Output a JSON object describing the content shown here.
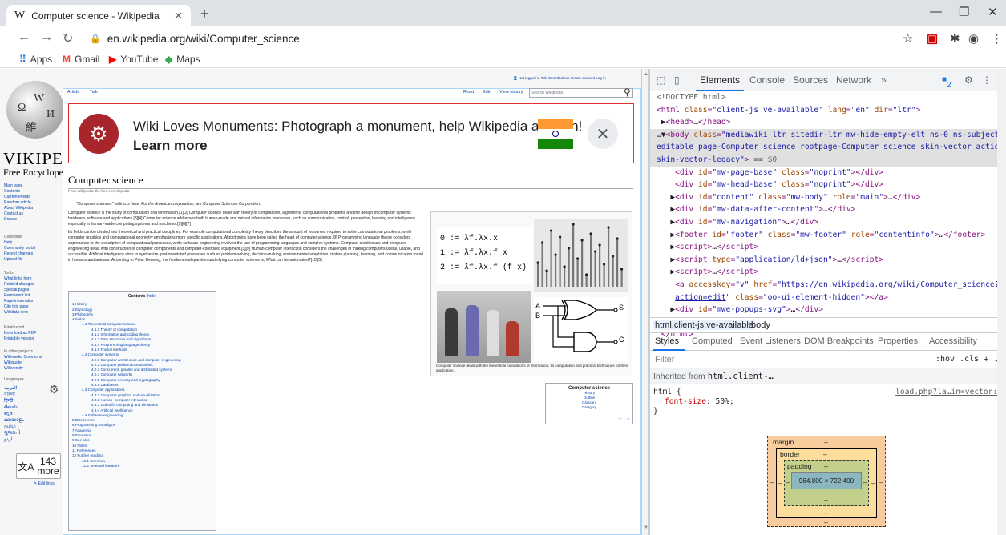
{
  "browser": {
    "tab_title": "Computer science - Wikipedia",
    "tab_favicon": "W",
    "new_tab": "+",
    "url": "en.wikipedia.org/wiki/Computer_science",
    "bookmarks": [
      {
        "label": "Apps",
        "icon": "apps-grid-icon",
        "color": "#1a73e8"
      },
      {
        "label": "Gmail",
        "icon": "gmail-icon",
        "color": "#ea4335"
      },
      {
        "label": "YouTube",
        "icon": "youtube-icon",
        "color": "#ff0000"
      },
      {
        "label": "Maps",
        "icon": "maps-icon",
        "color": "#34a853"
      }
    ]
  },
  "wiki": {
    "wordmark": "VIKIPEDI",
    "tagline": "Free Encyclope",
    "personal": "Not logged in  Talk  Contributions  Create account  Log in",
    "tabs": {
      "article": "Article",
      "talk": "Talk",
      "read": "Read",
      "edit": "Edit",
      "history": "View history"
    },
    "search_placeholder": "Search Wikipedia",
    "sidebar": {
      "nav": [
        "Main page",
        "Contents",
        "Current events",
        "Random article",
        "About Wikipedia",
        "Contact us",
        "Donate"
      ],
      "contribute_h": "Contribute",
      "contribute": [
        "Help",
        "Community portal",
        "Recent changes",
        "Upload file"
      ],
      "tools_h": "Tools",
      "tools": [
        "What links here",
        "Related changes",
        "Special pages",
        "Permanent link",
        "Page information",
        "Cite this page",
        "Wikidata item"
      ],
      "print_h": "Print/export",
      "print": [
        "Download as PDF",
        "Printable version"
      ],
      "projects_h": "In other projects",
      "projects": [
        "Wikimedia Commons",
        "Wikiquote",
        "Wikiversity"
      ],
      "languages_h": "Languages",
      "languages": [
        "العربية",
        "বাংলা",
        "हिन्दी",
        "తెలుగు",
        "ಕನ್ನಡ",
        "മലയാളം",
        "தமிழ்",
        "ગુજરાતી",
        "اردو"
      ],
      "more_count": "143",
      "more_label": "more",
      "edit_links": "Edit links"
    },
    "banner": {
      "message": "Wiki Loves Monuments: Photograph a monument, help Wikipedia and win!",
      "cta": "Learn more",
      "flag_colors": [
        "#ff9933",
        "#ffffff",
        "#138808"
      ]
    },
    "title": "Computer science",
    "from": "From Wikipedia, the free encyclopedia",
    "hatnote": "\"Computer sciences\" redirects here. For the American corporation, see Computer Sciences Corporation.",
    "para1": "Computer science is the study of computation and information.[1][2] Computer science deals with theory of computation, algorithms, computational problems and the design of computer systems hardware, software and applications.[3][4] Computer science addresses both human-made and natural information processes, such as communication, control, perception, learning and intelligence especially in human-made computing systems and machines.[5][6][7]",
    "para2": "Its fields can be divided into theoretical and practical disciplines. For example computational complexity theory describes the amount of resources required to solve computational problems, while computer graphics and computational geometry emphasizes more specific applications. Algorithmics have been called the heart of computer science.[8] Programming language theory considers approaches to the description of computational processes, while software engineering involves the use of programming languages and complex systems. Computer architecture and computer engineering deals with construction of computer components and computer-controlled equipment.[3][9] Human-computer interaction considers the challenges in making computers useful, usable, and accessible. Artificial intelligence aims to synthesize goal-orientated processes such as problem-solving, decision-making, environmental adaptation, motion planning, learning, and communication found in humans and animals. According to Peter Denning, the fundamental question underlying computer science is, What can be automated?[10][5]",
    "toc_title": "Contents",
    "toc_hide": "[hide]",
    "toc": [
      {
        "t": "1 History",
        "l": 1
      },
      {
        "t": "2 Etymology",
        "l": 1
      },
      {
        "t": "3 Philosophy",
        "l": 1
      },
      {
        "t": "4 Fields",
        "l": 1
      },
      {
        "t": "4.1 Theoretical computer science",
        "l": 2
      },
      {
        "t": "4.1.1 Theory of computation",
        "l": 3
      },
      {
        "t": "4.1.2 Information and coding theory",
        "l": 3
      },
      {
        "t": "4.1.3 Data structures and algorithms",
        "l": 3
      },
      {
        "t": "4.1.4 Programming language theory",
        "l": 3
      },
      {
        "t": "4.1.5 Formal methods",
        "l": 3
      },
      {
        "t": "4.2 Computer systems",
        "l": 2
      },
      {
        "t": "4.2.1 Computer architecture and computer engineering",
        "l": 3
      },
      {
        "t": "4.2.2 Computer performance analysis",
        "l": 3
      },
      {
        "t": "4.2.3 Concurrent, parallel and distributed systems",
        "l": 3
      },
      {
        "t": "4.2.4 Computer networks",
        "l": 3
      },
      {
        "t": "4.2.5 Computer security and cryptography",
        "l": 3
      },
      {
        "t": "4.2.6 Databases",
        "l": 3
      },
      {
        "t": "4.3 Computer applications",
        "l": 2
      },
      {
        "t": "4.3.1 Computer graphics and visualization",
        "l": 3
      },
      {
        "t": "4.3.2 Human–computer interaction",
        "l": 3
      },
      {
        "t": "4.3.3 Scientific computing and simulation",
        "l": 3
      },
      {
        "t": "4.3.4 Artificial intelligence",
        "l": 3
      },
      {
        "t": "4.4 Software engineering",
        "l": 2
      },
      {
        "t": "5 Discoveries",
        "l": 1
      },
      {
        "t": "6 Programming paradigms",
        "l": 1
      },
      {
        "t": "7 Academia",
        "l": 1
      },
      {
        "t": "8 Education",
        "l": 1
      },
      {
        "t": "9 See also",
        "l": 1
      },
      {
        "t": "10 Notes",
        "l": 1
      },
      {
        "t": "11 References",
        "l": 1
      },
      {
        "t": "12 Further reading",
        "l": 1
      },
      {
        "t": "12.1 Overview",
        "l": 2
      },
      {
        "t": "12.2 Selected literature",
        "l": 2
      }
    ],
    "lambda_lines": [
      "0 := λf.λx.x",
      "1 := λf.λx.f x",
      "2 := λf.λx.f (f x)"
    ],
    "gate_labels": {
      "a": "A",
      "b": "B",
      "s": "S",
      "c": "C"
    },
    "infobox_caption": "Computer science deals with the theoretical foundations of information, its computation and practical techniques for their application.",
    "navbox_title": "Computer science",
    "navbox_items": [
      "History",
      "Outline",
      "Glossary",
      "Category"
    ],
    "navbox_vte": "v · t · e"
  },
  "devtools": {
    "tabs": [
      "Elements",
      "Console",
      "Sources",
      "Network",
      "»"
    ],
    "issues_count": "2",
    "dom": [
      {
        "html": "<span class='cm'>&lt;!DOCTYPE html&gt;</span>"
      },
      {
        "html": "<span class='tg'>&lt;html</span> <span class='an'>class</span>=<span class='av'>\"client-js ve-available\"</span> <span class='an'>lang</span>=<span class='av'>\"en\"</span> <span class='an'>dir</span>=<span class='av'>\"ltr\"</span><span class='tg'>&gt;</span>"
      },
      {
        "html": " <span class='tx'>▶</span><span class='tg'>&lt;head&gt;</span><span class='tx'>…</span><span class='tg'>&lt;/head&gt;</span>"
      },
      {
        "html": "<span class='tx'>…▼</span><span class='tg'>&lt;body</span> <span class='an'>class</span>=<span class='av'>\"mediawiki ltr sitedir-ltr mw-hide-empty-elt ns-0 ns-subject mw-</span>",
        "sel": true
      },
      {
        "html": "<span class='av'>editable page-Computer_science rootpage-Computer_science skin-vector action-view</span>",
        "sel": true
      },
      {
        "html": "<span class='av'>skin-vector-legacy\"</span><span class='tg'>&gt;</span> <span class='tx'>== </span><span class='cm'>$0</span>",
        "sel": true
      },
      {
        "html": "    <span class='tg'>&lt;div</span> <span class='an'>id</span>=<span class='av'>\"mw-page-base\"</span> <span class='an'>class</span>=<span class='av'>\"noprint\"</span><span class='tg'>&gt;&lt;/div&gt;</span>"
      },
      {
        "html": "    <span class='tg'>&lt;div</span> <span class='an'>id</span>=<span class='av'>\"mw-head-base\"</span> <span class='an'>class</span>=<span class='av'>\"noprint\"</span><span class='tg'>&gt;&lt;/div&gt;</span>"
      },
      {
        "html": "   <span class='tx'>▶</span><span class='tg'>&lt;div</span> <span class='an'>id</span>=<span class='av'>\"content\"</span> <span class='an'>class</span>=<span class='av'>\"mw-body\"</span> <span class='an'>role</span>=<span class='av'>\"main\"</span><span class='tg'>&gt;</span><span class='tx'>…</span><span class='tg'>&lt;/div&gt;</span>"
      },
      {
        "html": "   <span class='tx'>▶</span><span class='tg'>&lt;div</span> <span class='an'>id</span>=<span class='av'>\"mw-data-after-content\"</span><span class='tg'>&gt;</span><span class='tx'>…</span><span class='tg'>&lt;/div&gt;</span>"
      },
      {
        "html": "   <span class='tx'>▶</span><span class='tg'>&lt;div</span> <span class='an'>id</span>=<span class='av'>\"mw-navigation\"</span><span class='tg'>&gt;</span><span class='tx'>…</span><span class='tg'>&lt;/div&gt;</span>"
      },
      {
        "html": "   <span class='tx'>▶</span><span class='tg'>&lt;footer</span> <span class='an'>id</span>=<span class='av'>\"footer\"</span> <span class='an'>class</span>=<span class='av'>\"mw-footer\"</span> <span class='an'>role</span>=<span class='av'>\"contentinfo\"</span><span class='tg'>&gt;</span><span class='tx'>…</span><span class='tg'>&lt;/footer&gt;</span>"
      },
      {
        "html": "   <span class='tx'>▶</span><span class='tg'>&lt;script&gt;</span><span class='tx'>…</span><span class='tg'>&lt;/script&gt;</span>"
      },
      {
        "html": "   <span class='tx'>▶</span><span class='tg'>&lt;script</span> <span class='an'>type</span>=<span class='av'>\"application/ld+json\"</span><span class='tg'>&gt;</span><span class='tx'>…</span><span class='tg'>&lt;/script&gt;</span>"
      },
      {
        "html": "   <span class='tx'>▶</span><span class='tg'>&lt;script&gt;</span><span class='tx'>…</span><span class='tg'>&lt;/script&gt;</span>"
      },
      {
        "html": "    <span class='tg'>&lt;a</span> <span class='an'>accesskey</span>=<span class='av'>\"v\"</span> <span class='an'>href</span>=<span class='av'>\"</span><span class='lk'>https://en.wikipedia.org/wiki/Computer_science?</span>"
      },
      {
        "html": "    <span class='lk'>action=edit</span><span class='av'>\"</span> <span class='an'>class</span>=<span class='av'>\"oo-ui-element-hidden\"</span><span class='tg'>&gt;&lt;/a&gt;</span>"
      },
      {
        "html": "   <span class='tx'>▶</span><span class='tg'>&lt;div</span> <span class='an'>id</span>=<span class='av'>\"mwe-popups-svg\"</span><span class='tg'>&gt;</span><span class='tx'>…</span><span class='tg'>&lt;/div&gt;</span>"
      },
      {
        "html": "  <span class='tg'>&lt;/body&gt;</span>"
      },
      {
        "html": " <span class='tg'>&lt;/html&gt;</span>"
      }
    ],
    "crumbs": [
      "html.client-js.ve-available",
      "body"
    ],
    "style_tabs": [
      "Styles",
      "Computed",
      "Event Listeners",
      "DOM Breakpoints",
      "Properties",
      "Accessibility"
    ],
    "filter_placeholder": "Filter",
    "hov": ":hov",
    "cls": ".cls",
    "inherited_label": "Inherited from",
    "inherited_sel": "html.client-…",
    "rule_selector": "html {",
    "rule_prop": "font-size",
    "rule_value": "50%;",
    "rule_close": "}",
    "rule_src": "load.php?la…in=vector:1",
    "box": {
      "margin_label": "margin",
      "border_label": "border",
      "padding_label": "padding",
      "content": "964.800 × 722.400",
      "dash": "–"
    }
  }
}
